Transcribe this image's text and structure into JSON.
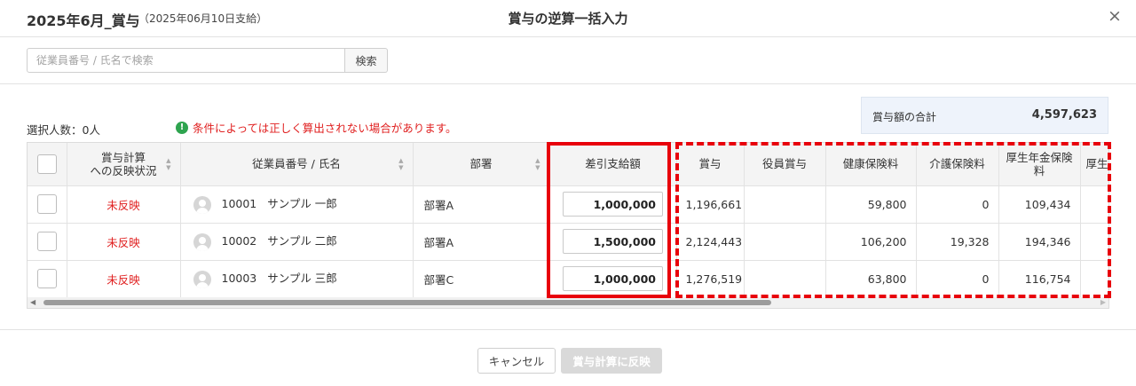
{
  "header": {
    "title": "2025年6月_賞与",
    "subtitle": "（2025年06月10日支給）",
    "dialog_title": "賞与の逆算一括入力",
    "close_glyph": "×"
  },
  "search": {
    "placeholder": "従業員番号 / 氏名で検索",
    "value": "",
    "button_label": "検索"
  },
  "summary": {
    "total_label": "賞与額の合計",
    "total_value": "4,597,623",
    "selected_count": "選択人数：0人",
    "warning_icon": "!",
    "warning_text": "条件によっては正しく算出されない場合があります。",
    "warning_icon_color": "#2ea44f",
    "warning_text_color": "#e02020"
  },
  "table": {
    "columns": {
      "status_line1": "賞与計算",
      "status_line2": "への反映状況",
      "employee": "従業員番号 / 氏名",
      "dept": "部署",
      "net_pay": "差引支給額",
      "bonus": "賞与",
      "officer_bonus": "役員賞与",
      "health_ins": "健康保険料",
      "care_ins": "介護保険料",
      "pension_line1": "厚生年金保険",
      "pension_line2": "料",
      "next_partial": "厚生"
    },
    "rows": [
      {
        "status": "未反映",
        "emp_no": "10001",
        "name": "サンプル 一郎",
        "dept": "部署A",
        "net_pay": "1,000,000",
        "bonus": "1,196,661",
        "officer_bonus": "",
        "health_ins": "59,800",
        "care_ins": "0",
        "pension": "109,434"
      },
      {
        "status": "未反映",
        "emp_no": "10002",
        "name": "サンプル 二郎",
        "dept": "部署A",
        "net_pay": "1,500,000",
        "bonus": "2,124,443",
        "officer_bonus": "",
        "health_ins": "106,200",
        "care_ins": "19,328",
        "pension": "194,346"
      },
      {
        "status": "未反映",
        "emp_no": "10003",
        "name": "サンプル 三郎",
        "dept": "部署C",
        "net_pay": "1,000,000",
        "bonus": "1,276,519",
        "officer_bonus": "",
        "health_ins": "63,800",
        "care_ins": "0",
        "pension": "116,754"
      }
    ]
  },
  "highlight_color": "#e8000b",
  "footer": {
    "cancel_label": "キャンセル",
    "apply_label": "賞与計算に反映"
  }
}
